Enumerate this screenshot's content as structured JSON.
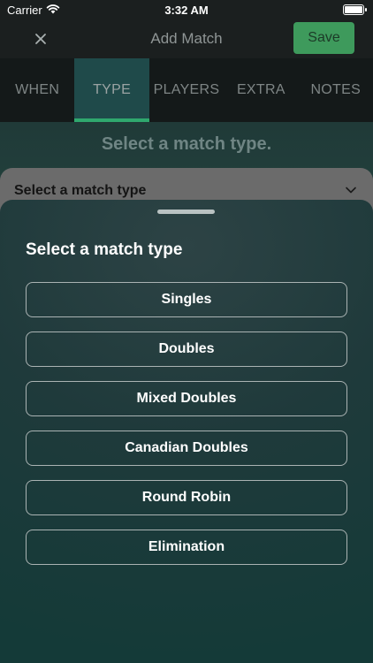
{
  "status_bar": {
    "carrier": "Carrier",
    "time": "3:32 AM"
  },
  "nav": {
    "title": "Add Match",
    "save_label": "Save"
  },
  "tabs": [
    {
      "label": "WHEN"
    },
    {
      "label": "TYPE"
    },
    {
      "label": "PLAYERS"
    },
    {
      "label": "EXTRA"
    },
    {
      "label": "NOTES"
    }
  ],
  "main": {
    "subtitle": "Select a match type.",
    "select_label": "Select a match type"
  },
  "sheet": {
    "title": "Select a match type",
    "options": [
      {
        "label": "Singles"
      },
      {
        "label": "Doubles"
      },
      {
        "label": "Mixed Doubles"
      },
      {
        "label": "Canadian Doubles"
      },
      {
        "label": "Round Robin"
      },
      {
        "label": "Elimination"
      }
    ]
  },
  "colors": {
    "accent": "#3e9a5c",
    "tab_indicator": "#2fa86e",
    "sheet_bg": "#1f3a3b"
  }
}
